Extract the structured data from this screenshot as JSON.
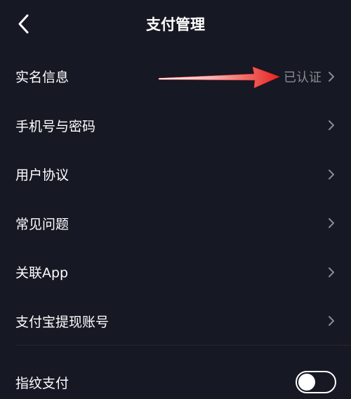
{
  "header": {
    "title": "支付管理"
  },
  "menu": {
    "items": [
      {
        "label": "实名信息",
        "value": "已认证"
      },
      {
        "label": "手机号与密码",
        "value": ""
      },
      {
        "label": "用户协议",
        "value": ""
      },
      {
        "label": "常见问题",
        "value": ""
      },
      {
        "label": "关联App",
        "value": ""
      },
      {
        "label": "支付宝提现账号",
        "value": ""
      }
    ]
  },
  "fingerprint": {
    "label": "指纹支付",
    "enabled": false
  },
  "icons": {
    "back": "chevron-left-icon",
    "row_arrow": "chevron-right-icon"
  },
  "colors": {
    "background": "#161823",
    "text_primary": "#ffffff",
    "text_secondary": "#8a8b91",
    "annotation": "#e8231f"
  }
}
